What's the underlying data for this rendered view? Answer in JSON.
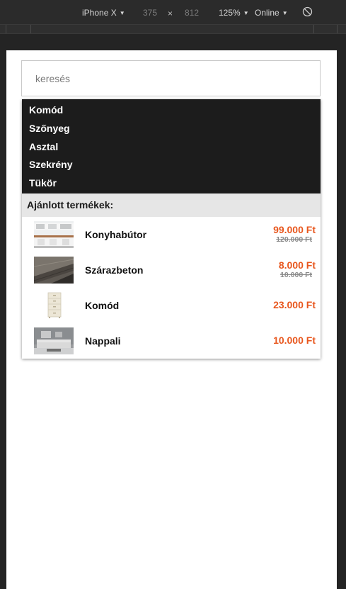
{
  "devtools": {
    "device": "iPhone X",
    "width": "375",
    "times": "×",
    "height": "812",
    "zoom": "125%",
    "network": "Online",
    "caret": "▼",
    "rotate_icon": "rotate-icon"
  },
  "search": {
    "placeholder": "keresés"
  },
  "suggestions": [
    "Komód",
    "Szőnyeg",
    "Asztal",
    "Szekrény",
    "Tükör"
  ],
  "recommended": {
    "title": "Ajánlott termékek:",
    "products": [
      {
        "name": "Konyhabútor",
        "price": "99.000 Ft",
        "old_price": "120.000 Ft"
      },
      {
        "name": "Szárazbeton",
        "price": "8.000 Ft",
        "old_price": "10.000 Ft"
      },
      {
        "name": "Komód",
        "price": "23.000 Ft",
        "old_price": ""
      },
      {
        "name": "Nappali",
        "price": "10.000 Ft",
        "old_price": ""
      }
    ]
  },
  "colors": {
    "price": "#e8571e",
    "suggest_bg": "#1c1c1c"
  }
}
